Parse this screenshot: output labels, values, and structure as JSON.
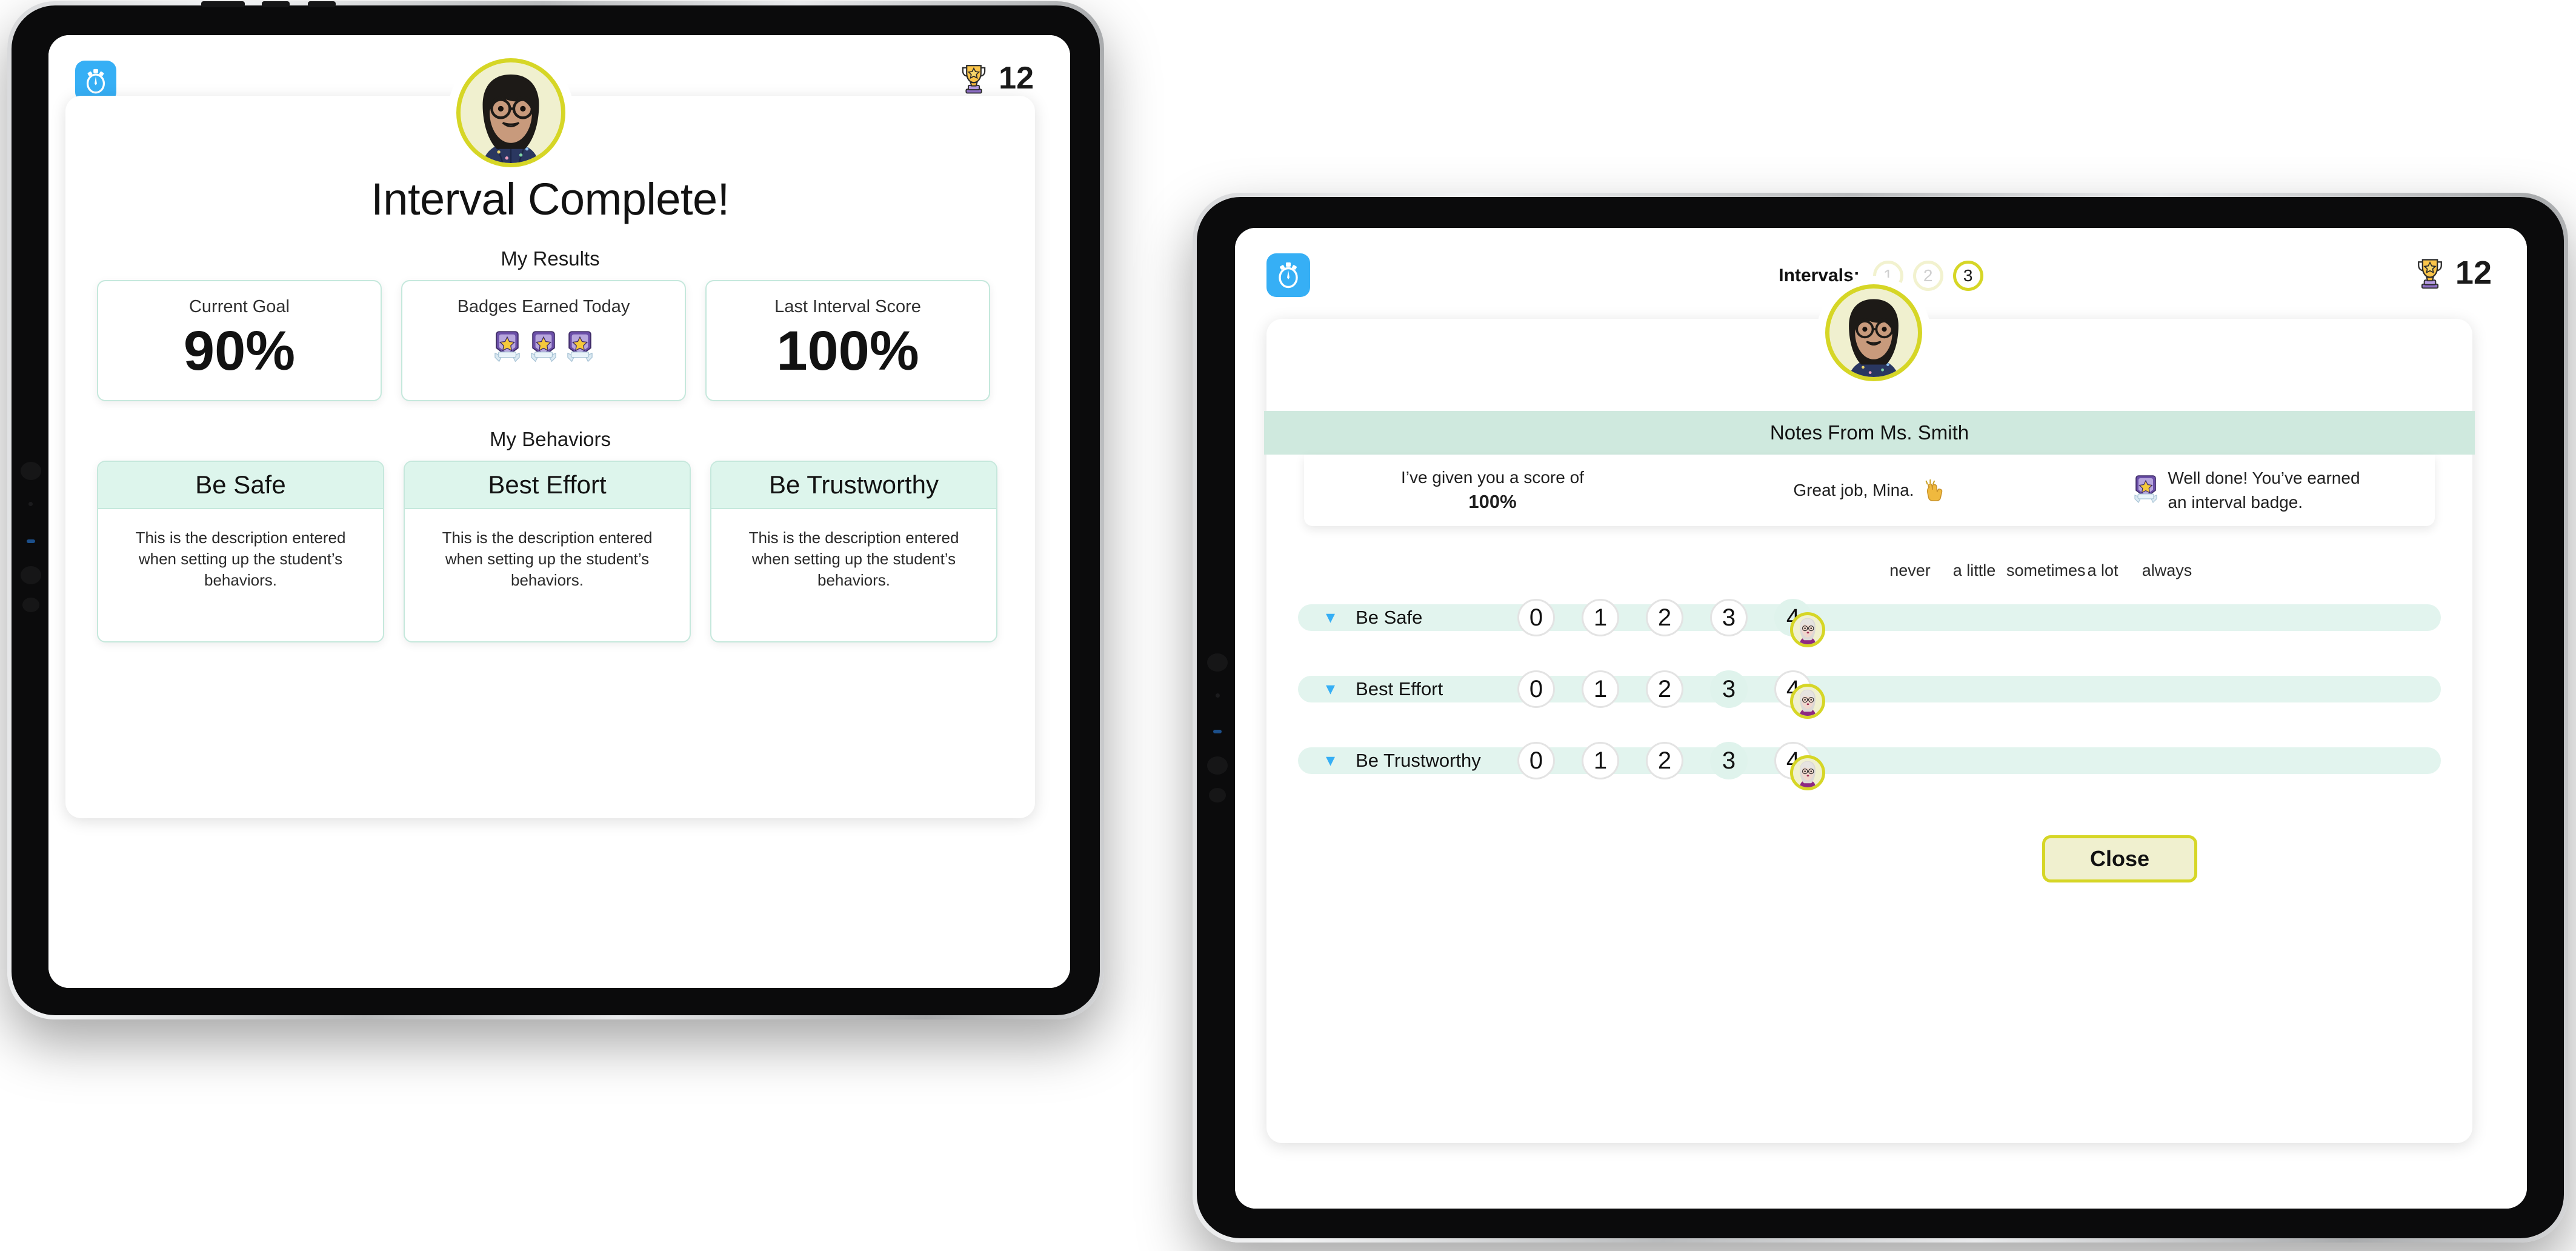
{
  "colors": {
    "brand_blue": "#36aff5",
    "mint_border": "#c5e8dc",
    "mint_fill": "#ddf5ec",
    "mint_pill": "#e2f4ee",
    "notes_header": "#cfe9de",
    "yellow_ring": "#d6d626",
    "yellow_fill": "#f0f0cf",
    "text_dark": "#121212"
  },
  "back_tablet": {
    "logo_icon": "stopwatch-icon",
    "trophy_icon": "trophy-icon",
    "trophy_count": "12",
    "avatar_icon": "student-avatar",
    "title": "Interval Complete!",
    "results_heading": "My Results",
    "stats": [
      {
        "label": "Current Goal",
        "value": "90%",
        "kind": "value"
      },
      {
        "label": "Badges Earned Today",
        "value": "",
        "kind": "badges",
        "badge_count": 3,
        "badge_icon": "award-badge-icon"
      },
      {
        "label": "Last Interval Score",
        "value": "100%",
        "kind": "value"
      }
    ],
    "behaviors_heading": "My Behaviors",
    "behaviors": [
      {
        "title": "Be Safe",
        "description": "This is the description entered when setting up the student’s behaviors."
      },
      {
        "title": "Best Effort",
        "description": "This is the description entered when setting up the student’s behaviors."
      },
      {
        "title": "Be Trustworthy",
        "description": "This is the description entered when setting up the student’s behaviors."
      }
    ]
  },
  "front_tablet": {
    "logo_icon": "stopwatch-icon",
    "trophy_icon": "trophy-icon",
    "trophy_count": "12",
    "intervals_label": "Intervals:",
    "intervals": [
      {
        "number": "1",
        "state": "done"
      },
      {
        "number": "2",
        "state": "done"
      },
      {
        "number": "3",
        "state": "active"
      }
    ],
    "avatar_icon": "student-avatar",
    "notes_title": "Notes From Ms. Smith",
    "notes": {
      "score_intro": "I’ve given you a score of",
      "score_value": "100%",
      "praise_text": "Great job, Mina.",
      "praise_icon": "clapping-hands-icon",
      "badge_icon": "award-badge-icon",
      "badge_line1": "Well done! You’ve earned",
      "badge_line2": "an interval badge."
    },
    "scale_labels": [
      "never",
      "a little",
      "sometimes",
      "a lot",
      "always"
    ],
    "scale_values": [
      "0",
      "1",
      "2",
      "3",
      "4"
    ],
    "ratings": [
      {
        "behavior": "Be Safe",
        "selected": "4",
        "chevron_icon": "chevron-down-icon",
        "marker_icon": "teacher-avatar"
      },
      {
        "behavior": "Best Effort",
        "selected": "4",
        "chevron_icon": "chevron-down-icon",
        "marker_icon": "teacher-avatar"
      },
      {
        "behavior": "Be Trustworthy",
        "selected": "4",
        "chevron_icon": "chevron-down-icon",
        "marker_icon": "teacher-avatar"
      }
    ],
    "close_label": "Close"
  }
}
